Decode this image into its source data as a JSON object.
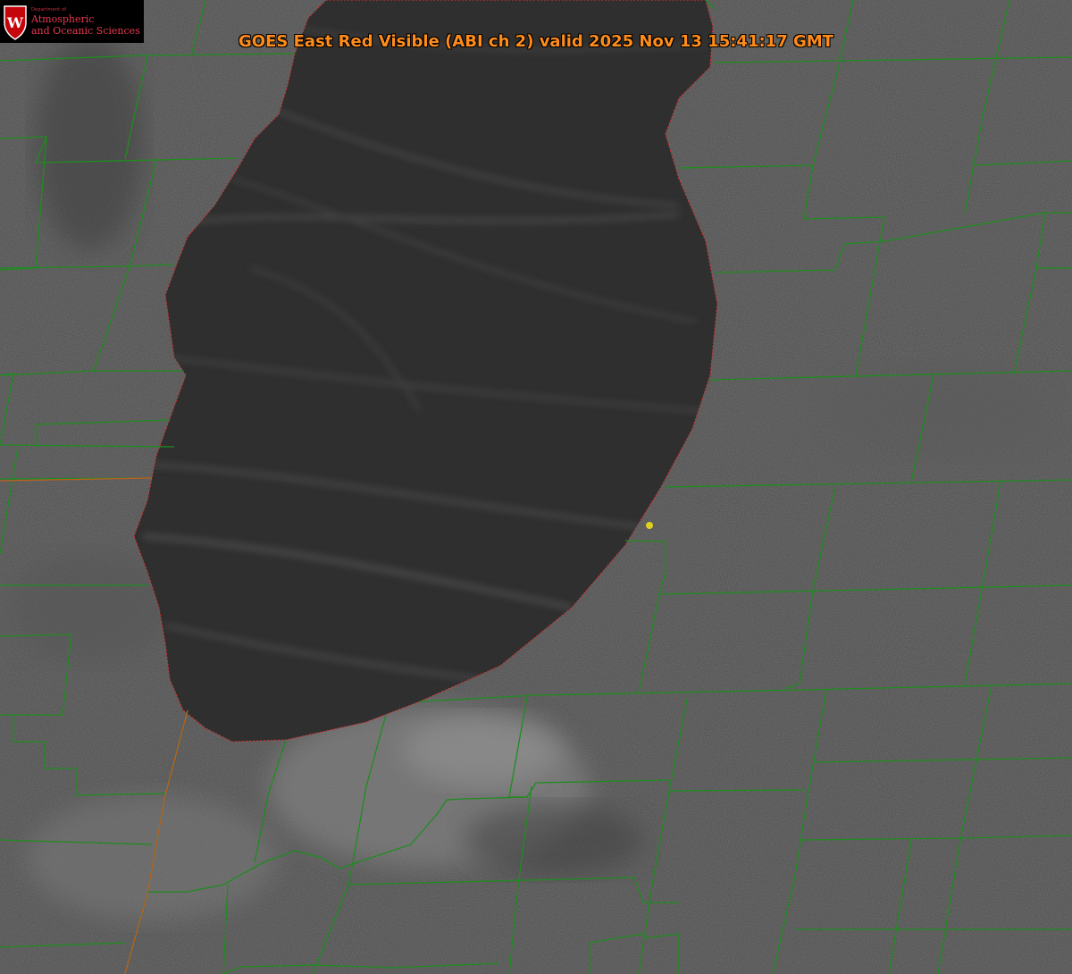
{
  "title": "GOES East Red Visible (ABI ch 2) valid 2025 Nov 13 15:41:17 GMT",
  "logo": {
    "department": "Department of",
    "line1": "Atmospheric",
    "line2": "and Oceanic Sciences",
    "seal_letter": "W"
  },
  "colors": {
    "land": "#4a4a4a",
    "lake": "#2e2e2e",
    "county_lines": "#1f8c1f",
    "shoreline": "#e03030",
    "title": "#ff8c1a",
    "marker": "#e0d020",
    "logo_text": "#e83850"
  },
  "marker": {
    "label": ""
  }
}
